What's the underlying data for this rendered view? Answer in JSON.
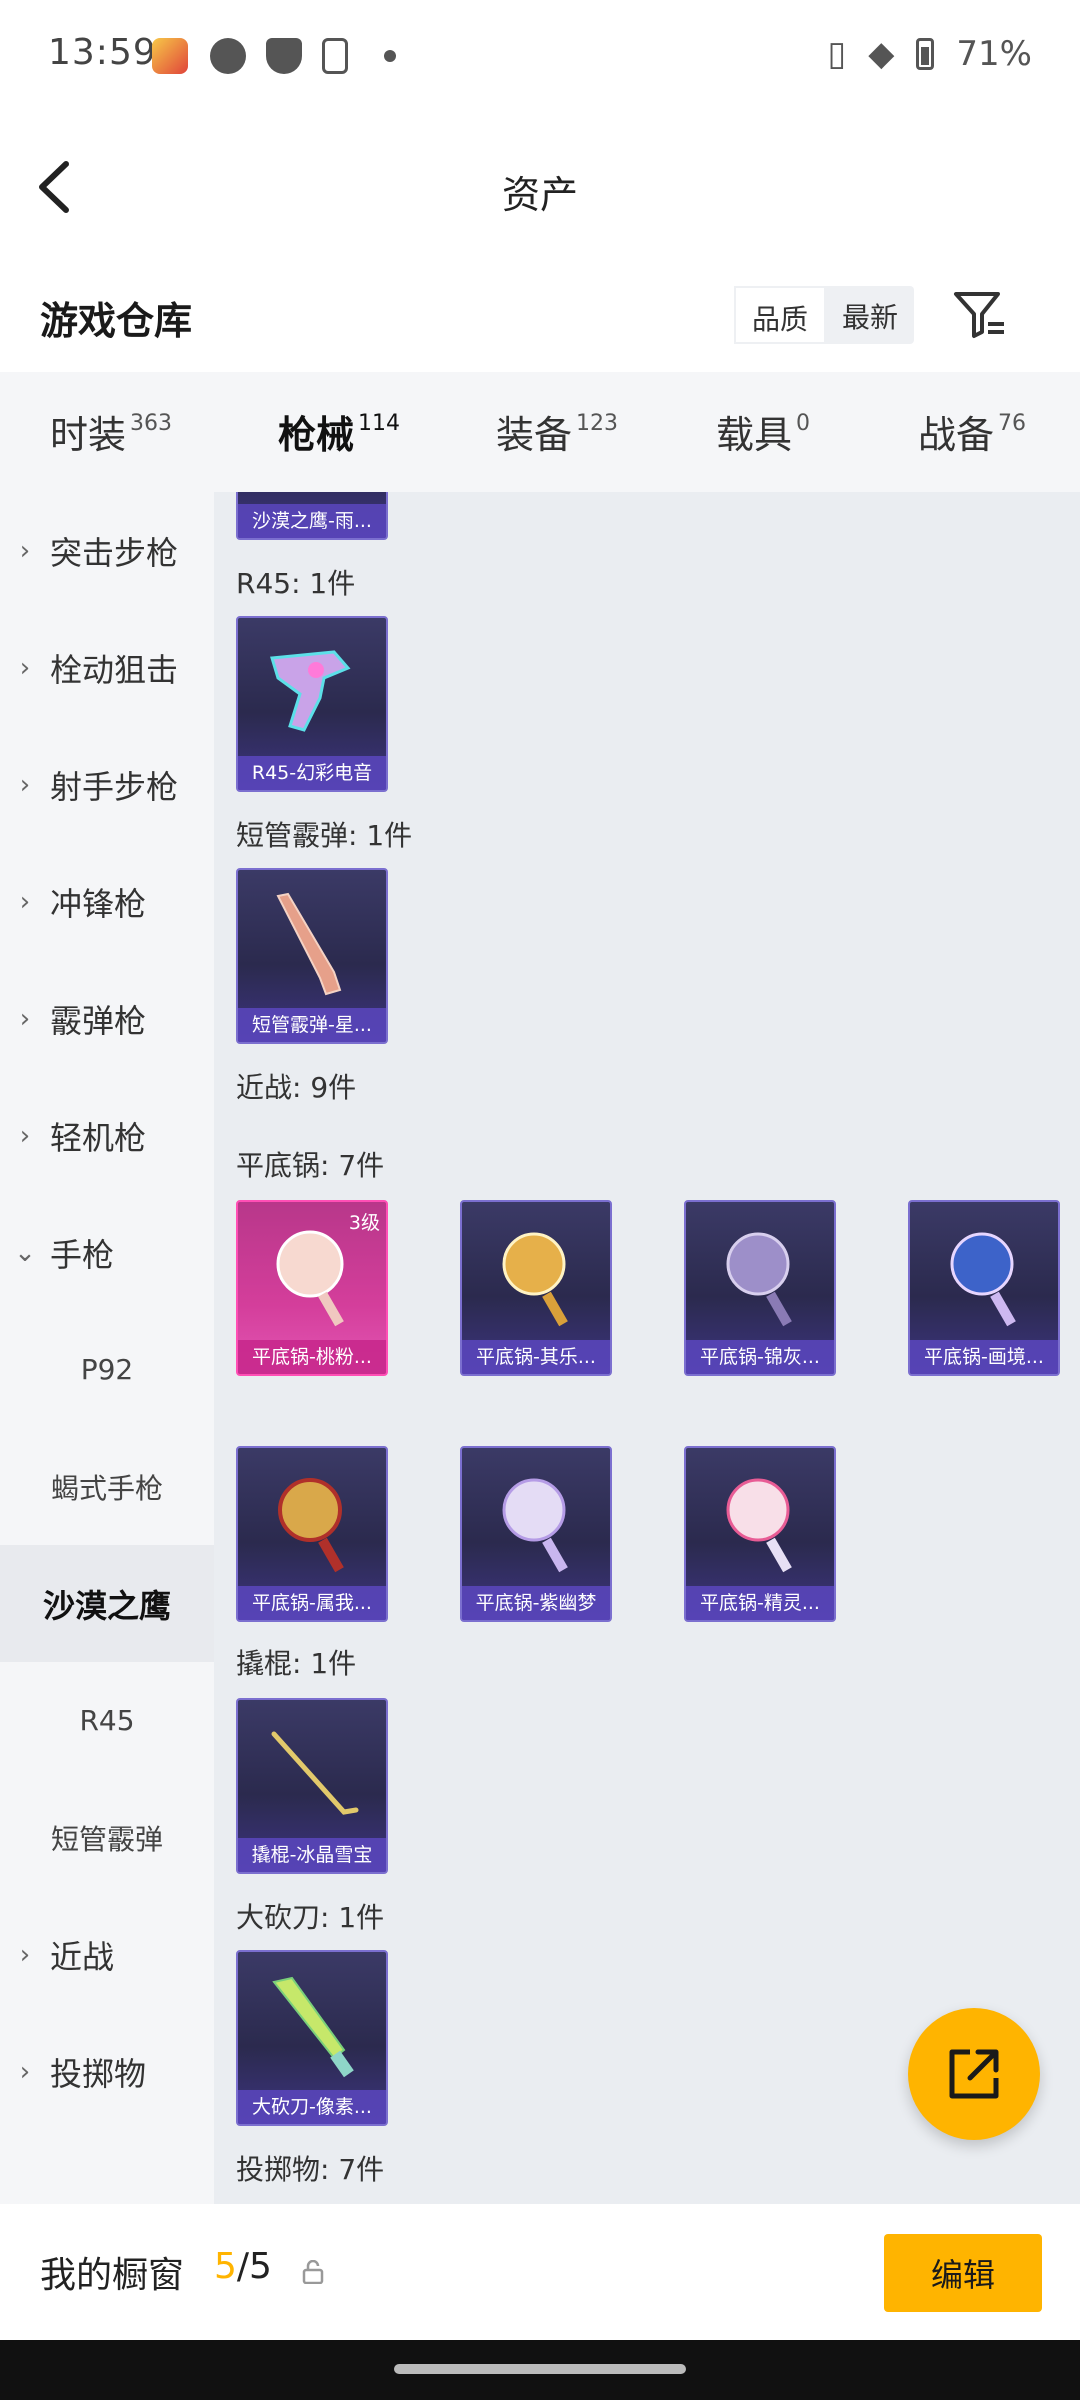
{
  "status_bar": {
    "time": "13:59",
    "battery": "71%"
  },
  "header": {
    "title": "资产"
  },
  "subheader": {
    "title": "游戏仓库",
    "sort_options": [
      "品质",
      "最新"
    ]
  },
  "tabs": [
    {
      "label": "时装",
      "count": "363"
    },
    {
      "label": "枪械",
      "count": "114"
    },
    {
      "label": "装备",
      "count": "123"
    },
    {
      "label": "载具",
      "count": "0"
    },
    {
      "label": "战备",
      "count": "76"
    }
  ],
  "sidebar": [
    {
      "label": "突击步枪",
      "chevron": "›"
    },
    {
      "label": "栓动狙击",
      "chevron": "›"
    },
    {
      "label": "射手步枪",
      "chevron": "›"
    },
    {
      "label": "冲锋枪",
      "chevron": "›"
    },
    {
      "label": "霰弹枪",
      "chevron": "›"
    },
    {
      "label": "轻机枪",
      "chevron": "›"
    },
    {
      "label": "手枪",
      "chevron": "⌄"
    },
    {
      "label": "P92"
    },
    {
      "label": "蝎式手枪"
    },
    {
      "label": "沙漠之鹰"
    },
    {
      "label": "R45"
    },
    {
      "label": "短管霰弹"
    },
    {
      "label": "近战",
      "chevron": "›"
    },
    {
      "label": "投掷物",
      "chevron": "›"
    }
  ],
  "content": {
    "labels": [
      "R45: 1件",
      "短管霰弹: 1件",
      "近战: 9件",
      "平底锅: 7件",
      "撬棍: 1件",
      "大砍刀: 1件",
      "投掷物: 7件"
    ],
    "items": [
      {
        "name": "沙漠之鹰-雨...",
        "art": "pistol"
      },
      {
        "name": "R45-幻彩电音",
        "art": "revolver-icon"
      },
      {
        "name": "短管霰弹-星...",
        "art": "shotgun-icon"
      },
      {
        "name": "平底锅-桃粉...",
        "art": "pan-icon",
        "level": "3级"
      },
      {
        "name": "平底锅-其乐...",
        "art": "pan-icon"
      },
      {
        "name": "平底锅-锦灰...",
        "art": "pan-icon"
      },
      {
        "name": "平底锅-画境...",
        "art": "pan-icon"
      },
      {
        "name": "平底锅-属我...",
        "art": "pan-icon"
      },
      {
        "name": "平底锅-紫幽梦",
        "art": "pan-icon"
      },
      {
        "name": "平底锅-精灵...",
        "art": "pan-icon"
      },
      {
        "name": "撬棍-冰晶雪宝",
        "art": "crowbar-icon"
      },
      {
        "name": "大砍刀-像素...",
        "art": "machete-icon"
      }
    ]
  },
  "colors": {
    "accent": "#ffb400",
    "card_purple": "#2b2a4e",
    "card_pink": "#d43e9b"
  },
  "bottom_bar": {
    "title": "我的橱窗",
    "count_current": "5",
    "count_total": "/5",
    "edit_label": "编辑"
  }
}
